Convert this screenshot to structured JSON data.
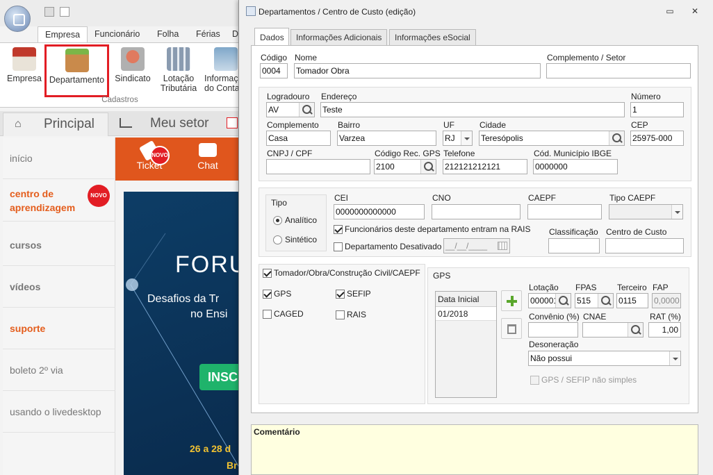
{
  "app": {
    "ribbon_tabs": [
      "Empresa",
      "Funcionário",
      "Folha",
      "Férias",
      "D"
    ],
    "ribbon_buttons": [
      {
        "label": "Empresa",
        "icon": "company-icon"
      },
      {
        "label": "Departamento",
        "icon": "desk-icon"
      },
      {
        "label": "Sindicato",
        "icon": "people-icon"
      },
      {
        "label": "Lotação",
        "label2": "Tributária",
        "icon": "calculator-icon"
      },
      {
        "label": "Informaç",
        "label2": "do Conta",
        "icon": "caduceus-icon"
      }
    ],
    "ribbon_group_label": "Cadastros",
    "nav_tabs": {
      "home": "Principal",
      "sector": "Meu setor"
    },
    "sidebar": [
      "início",
      "centro de aprendizagem",
      "cursos",
      "vídeos",
      "suporte",
      "boleto 2º via",
      "usando o livedesktop"
    ],
    "novo_badge": "NOVO",
    "topbar": {
      "ticket": "Ticket",
      "chat": "Chat"
    },
    "banner": {
      "title": "FORU",
      "line1": "Desafios da Tr",
      "line2": "no Ensi",
      "button": "INSC",
      "date": "26 a 28 d",
      "footer": "Br"
    }
  },
  "dialog": {
    "title": "Departamentos / Centro de Custo (edição)",
    "tabs": [
      "Dados",
      "Informações Adicionais",
      "Informações eSocial"
    ],
    "active_tab": "Dados",
    "codigo": {
      "label": "Código",
      "value": "0004"
    },
    "nome": {
      "label": "Nome",
      "value": "Tomador Obra"
    },
    "complemento_setor": {
      "label": "Complemento / Setor",
      "value": ""
    },
    "logradouro": {
      "label": "Logradouro",
      "value": "AV"
    },
    "endereco": {
      "label": "Endereço",
      "value": "Teste"
    },
    "numero": {
      "label": "Número",
      "value": "1"
    },
    "complemento": {
      "label": "Complemento",
      "value": "Casa"
    },
    "bairro": {
      "label": "Bairro",
      "value": "Varzea"
    },
    "uf": {
      "label": "UF",
      "value": "RJ"
    },
    "cidade": {
      "label": "Cidade",
      "value": "Teresópolis"
    },
    "cep": {
      "label": "CEP",
      "value": "25975-000"
    },
    "cnpj": {
      "label": "CNPJ / CPF",
      "value": ""
    },
    "codigo_gps": {
      "label": "Código Rec. GPS",
      "value": "2100"
    },
    "telefone": {
      "label": "Telefone",
      "value": "212121212121"
    },
    "cod_municipio": {
      "label": "Cód. Município IBGE",
      "value": "0000000"
    },
    "tipo": {
      "label": "Tipo",
      "options": [
        "Analítico",
        "Sintético"
      ],
      "selected": "Analítico"
    },
    "cei": {
      "label": "CEI",
      "value": "0000000000000"
    },
    "cno": {
      "label": "CNO",
      "value": ""
    },
    "caepf": {
      "label": "CAEPF",
      "value": ""
    },
    "tipo_caepf": {
      "label": "Tipo CAEPF",
      "value": ""
    },
    "func_rais": {
      "label": "Funcionários deste departamento entram na RAIS",
      "checked": true
    },
    "desativado": {
      "label": "Departamento Desativado",
      "checked": false,
      "date_placeholder": "__/__/____"
    },
    "classificacao": {
      "label": "Classificação",
      "value": ""
    },
    "centro_custo": {
      "label": "Centro de Custo",
      "value": ""
    },
    "tomador": {
      "label": "Tomador/Obra/Construção Civil/CAEPF",
      "checked": true
    },
    "gps_chk": {
      "label": "GPS",
      "checked": true
    },
    "sefip_chk": {
      "label": "SEFIP",
      "checked": true
    },
    "caged_chk": {
      "label": "CAGED",
      "checked": false
    },
    "rais_chk": {
      "label": "RAIS",
      "checked": false
    },
    "gps_group": {
      "label": "GPS",
      "list_header": "Data Inicial",
      "rows": [
        "01/2018"
      ],
      "lotacao": {
        "label": "Lotação",
        "value": "000001"
      },
      "fpas": {
        "label": "FPAS",
        "value": "515"
      },
      "terceiro": {
        "label": "Terceiro",
        "value": "0115"
      },
      "fap": {
        "label": "FAP",
        "value": "0,0000"
      },
      "convenio": {
        "label": "Convênio (%)",
        "value": ""
      },
      "cnae": {
        "label": "CNAE",
        "value": ""
      },
      "rat": {
        "label": "RAT (%)",
        "value": "1,00"
      },
      "desoneracao": {
        "label": "Desoneração",
        "value": "Não possui"
      },
      "nao_simples": {
        "label": "GPS / SEFIP não simples",
        "checked": false
      }
    },
    "comentario": {
      "label": "Comentário"
    }
  }
}
